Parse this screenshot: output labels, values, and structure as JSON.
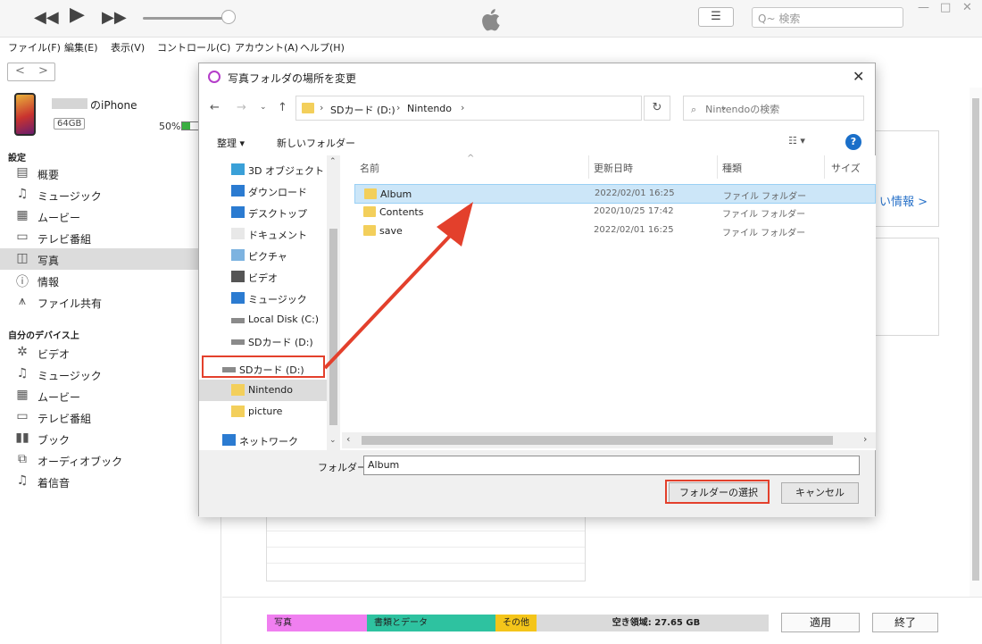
{
  "topbar": {
    "rewind": "◀◀",
    "play": "▶",
    "forward": "▶▶",
    "search_placeholder": "Q~ 検索",
    "minimize": "—",
    "maximize": "□",
    "close": "✕"
  },
  "menu": [
    "ファイル(F)",
    "編集(E)",
    "表示(V)",
    "コントロール(C)",
    "アカウント(A)",
    "ヘルプ(H)"
  ],
  "device": {
    "name": "のiPhone",
    "capacity": "64GB",
    "battery": "50%",
    "battery_level": 0.5
  },
  "sidebar": {
    "settings_heading": "設定",
    "settings_items": [
      {
        "icon": "summary-icon",
        "label": "概要"
      },
      {
        "icon": "music-icon",
        "label": "ミュージック"
      },
      {
        "icon": "movie-icon",
        "label": "ムービー"
      },
      {
        "icon": "tv-icon",
        "label": "テレビ番組"
      },
      {
        "icon": "photo-icon",
        "label": "写真"
      },
      {
        "icon": "info-icon",
        "label": "情報"
      },
      {
        "icon": "file-share-icon",
        "label": "ファイル共有"
      }
    ],
    "device_heading": "自分のデバイス上",
    "device_items": [
      {
        "icon": "gear-icon",
        "label": "ビデオ"
      },
      {
        "icon": "music-icon",
        "label": "ミュージック"
      },
      {
        "icon": "movie-icon",
        "label": "ムービー"
      },
      {
        "icon": "tv-icon",
        "label": "テレビ番組"
      },
      {
        "icon": "book-icon",
        "label": "ブック"
      },
      {
        "icon": "audiobook-icon",
        "label": "オーディオブック"
      },
      {
        "icon": "bell-icon",
        "label": "着信音"
      }
    ]
  },
  "main": {
    "more_info": "い情報 >"
  },
  "storage": {
    "photos": "写真",
    "docs": "書類とデータ",
    "other": "その他",
    "free": "空き領域: 27.65 GB"
  },
  "bottom_buttons": {
    "apply": "適用",
    "done": "終了"
  },
  "dialog": {
    "title": "写真フォルダの場所を変更",
    "close": "✕",
    "path": [
      "SDカード (D:)",
      "Nintendo"
    ],
    "search_placeholder": "Nintendoの検索",
    "organize": "整理 ▾",
    "new_folder": "新しいフォルダー",
    "help": "?",
    "nav_items": [
      {
        "label": "3D オブジェクト",
        "icon": "3d-objects-icon"
      },
      {
        "label": "ダウンロード",
        "icon": "download-icon"
      },
      {
        "label": "デスクトップ",
        "icon": "desktop-icon"
      },
      {
        "label": "ドキュメント",
        "icon": "document-icon"
      },
      {
        "label": "ピクチャ",
        "icon": "pictures-icon"
      },
      {
        "label": "ビデオ",
        "icon": "video-icon"
      },
      {
        "label": "ミュージック",
        "icon": "music-icon"
      },
      {
        "label": "Local Disk (C:)",
        "icon": "drive-icon"
      },
      {
        "label": "SDカード (D:)",
        "icon": "drive-icon"
      },
      {
        "label": "SDカード (D:)",
        "icon": "drive-icon"
      },
      {
        "label": "Nintendo",
        "icon": "folder-icon"
      },
      {
        "label": "picture",
        "icon": "folder-icon"
      },
      {
        "label": "ネットワーク",
        "icon": "network-icon"
      }
    ],
    "columns": [
      "名前",
      "更新日時",
      "種類",
      "サイズ"
    ],
    "files": [
      {
        "name": "Album",
        "date": "2022/02/01 16:25",
        "type": "ファイル フォルダー"
      },
      {
        "name": "Contents",
        "date": "2020/10/25 17:42",
        "type": "ファイル フォルダー"
      },
      {
        "name": "save",
        "date": "2022/02/01 16:25",
        "type": "ファイル フォルダー"
      }
    ],
    "folder_label": "フォルダー:",
    "folder_value": "Album",
    "select_button": "フォルダーの選択",
    "cancel_button": "キャンセル"
  },
  "colors": {
    "highlight_red": "#e3402c",
    "selection_blue": "#cce6f8",
    "folder_yellow": "#f3cf5b",
    "storage_photos": "#f07ff0",
    "storage_docs": "#2ec2a0",
    "storage_other": "#f4c51a"
  }
}
